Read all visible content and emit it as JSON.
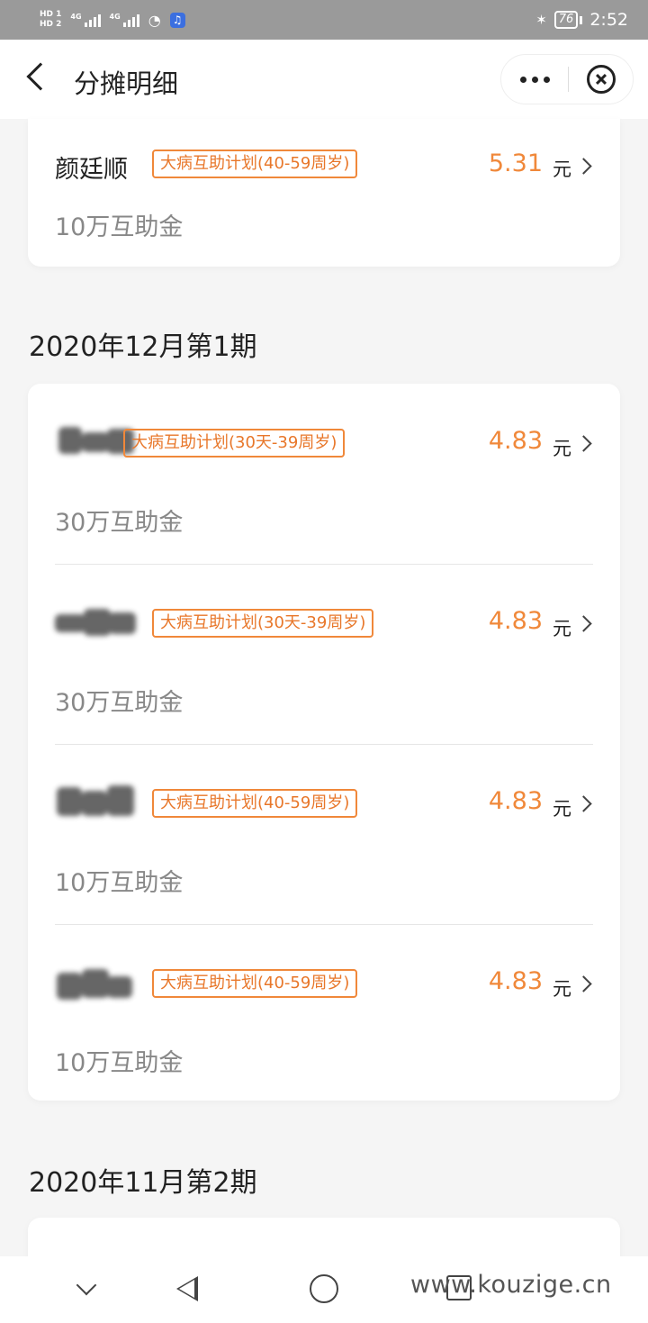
{
  "status_bar": {
    "hd1": "HD 1",
    "hd2": "HD 2",
    "net1": "4G",
    "net2": "4G",
    "battery": "76",
    "time": "2:52",
    "icons": [
      "signal-icon",
      "wifi-icon",
      "music-icon",
      "bluetooth-icon",
      "battery-icon"
    ]
  },
  "nav": {
    "title": "分摊明细",
    "icons": [
      "back-icon",
      "more-icon",
      "close-icon"
    ]
  },
  "top_card": {
    "name": "颜廷顺",
    "plan": "大病互助计划(40-59周岁)",
    "amount": "5.31",
    "unit": "元",
    "fund": "10万互助金"
  },
  "sections": [
    {
      "title": "2020年12月第1期",
      "items": [
        {
          "plan": "大病互助计划(30天-39周岁)",
          "amount": "4.83",
          "unit": "元",
          "fund": "30万互助金"
        },
        {
          "plan": "大病互助计划(30天-39周岁)",
          "amount": "4.83",
          "unit": "元",
          "fund": "30万互助金"
        },
        {
          "plan": "大病互助计划(40-59周岁)",
          "amount": "4.83",
          "unit": "元",
          "fund": "10万互助金"
        },
        {
          "plan": "大病互助计划(40-59周岁)",
          "amount": "4.83",
          "unit": "元",
          "fund": "10万互助金"
        }
      ]
    },
    {
      "title": "2020年11月第2期",
      "items": []
    }
  ],
  "system_nav": {
    "icons": [
      "chevron-down-icon",
      "back-triangle-icon",
      "home-circle-icon",
      "recent-square-icon"
    ],
    "watermark": "www.kouzige.cn"
  },
  "colors": {
    "accent": "#f0883a",
    "background": "#f5f5f5",
    "card": "#ffffff",
    "muted_text": "#888888"
  }
}
